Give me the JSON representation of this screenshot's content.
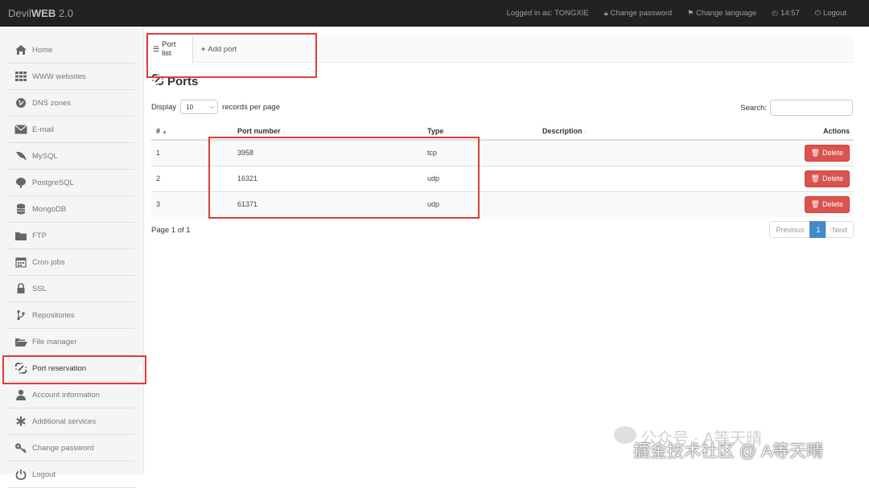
{
  "navbar": {
    "brand_prefix": "Devil",
    "brand_bold": "WEB",
    "brand_suffix": " 2.0",
    "logged_in": "Logged in as: TONGXIE",
    "change_password": "Change password",
    "change_language": "Change language",
    "time": "14:57",
    "logout": "Logout"
  },
  "sidebar": {
    "items": [
      {
        "label": "Home",
        "icon": "home-icon"
      },
      {
        "label": "WWW websites",
        "icon": "grid-icon"
      },
      {
        "label": "DNS zones",
        "icon": "globe-icon"
      },
      {
        "label": "E-mail",
        "icon": "envelope-icon"
      },
      {
        "label": "MySQL",
        "icon": "dolphin-icon"
      },
      {
        "label": "PostgreSQL",
        "icon": "elephant-icon"
      },
      {
        "label": "MongoDB",
        "icon": "database-icon"
      },
      {
        "label": "FTP",
        "icon": "folder-icon"
      },
      {
        "label": "Cron jobs",
        "icon": "calendar-icon"
      },
      {
        "label": "SSL",
        "icon": "lock-icon"
      },
      {
        "label": "Repositories",
        "icon": "branch-icon"
      },
      {
        "label": "File manager",
        "icon": "folder-open-icon"
      },
      {
        "label": "Port reservation",
        "icon": "link-broken-icon"
      },
      {
        "label": "Account information",
        "icon": "user-icon"
      },
      {
        "label": "Additional services",
        "icon": "asterisk-icon"
      },
      {
        "label": "Change password",
        "icon": "key-icon"
      },
      {
        "label": "Logout",
        "icon": "power-icon"
      }
    ]
  },
  "tabs": {
    "port_list": "Port list",
    "add_port": "Add port"
  },
  "page_title": "Ports",
  "controls": {
    "display_label": "Display",
    "page_size": "10",
    "records_label": "records per page",
    "search_label": "Search:"
  },
  "table": {
    "headers": [
      "#",
      "Port number",
      "Type",
      "Description",
      "Actions"
    ],
    "rows": [
      {
        "num": "1",
        "port": "3958",
        "type": "tcp",
        "description": "",
        "action": "Delete"
      },
      {
        "num": "2",
        "port": "16321",
        "type": "udp",
        "description": "",
        "action": "Delete"
      },
      {
        "num": "3",
        "port": "61371",
        "type": "udp",
        "description": "",
        "action": "Delete"
      }
    ]
  },
  "pagination": {
    "info": "Page 1 of 1",
    "previous": "Previous",
    "current": "1",
    "next": "Next"
  },
  "watermark": {
    "line1": "公众号 · A等天晴",
    "line2": "掘金技术社区 @ A等天晴"
  },
  "colors": {
    "navbar_bg": "#222222",
    "danger": "#d9534f",
    "primary": "#428bca",
    "annotation_red": "#e03c3c"
  }
}
